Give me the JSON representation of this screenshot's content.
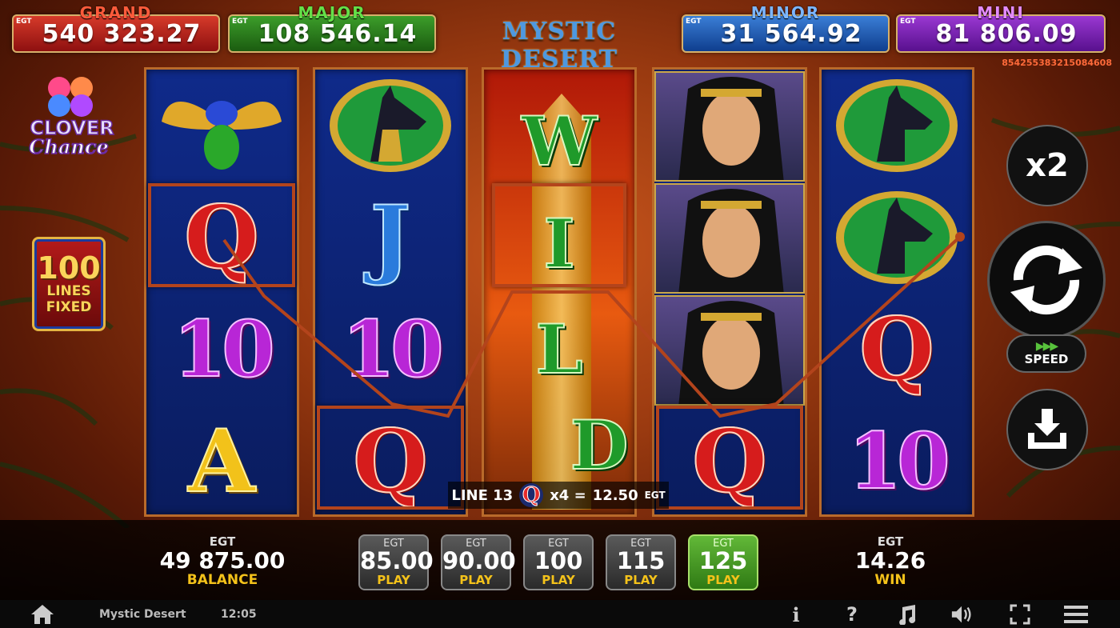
{
  "title": "MYSTIC DESERT",
  "round_id": "854255383215084608",
  "jackpots": {
    "grand": {
      "label": "GRAND",
      "currency": "EGT",
      "value": "540 323.27"
    },
    "major": {
      "label": "MAJOR",
      "currency": "EGT",
      "value": "108 546.14"
    },
    "minor": {
      "label": "MINOR",
      "currency": "EGT",
      "value": "31 564.92"
    },
    "mini": {
      "label": "MINI",
      "currency": "EGT",
      "value": "81 806.09"
    }
  },
  "logo": {
    "line1": "CLOVER",
    "line2": "Chance"
  },
  "lines_badge": {
    "number": "100",
    "line1": "LINES",
    "line2": "FIXED"
  },
  "reels": {
    "reel1": [
      "scarab",
      "Q",
      "10",
      "A"
    ],
    "reel2": [
      "anubis",
      "J",
      "10",
      "Q"
    ],
    "reel3": [
      "W",
      "I",
      "L",
      "D"
    ],
    "reel4": [
      "queen",
      "queen",
      "queen",
      "Q"
    ],
    "reel5": [
      "anubis",
      "anubis",
      "Q",
      "10"
    ]
  },
  "win_line": {
    "label": "LINE 13",
    "symbol": "Q",
    "multiplier": "x4 =",
    "amount": "12.50",
    "currency": "EGT"
  },
  "buttons": {
    "multiplier": "x2",
    "spin_icon": "refresh-icon",
    "speed_label": "SPEED",
    "speed_arrows": "▶▶▶",
    "collect_icon": "collect-icon"
  },
  "balance": {
    "currency": "EGT",
    "amount": "49 875.00",
    "label": "BALANCE"
  },
  "win": {
    "currency": "EGT",
    "amount": "14.26",
    "label": "WIN"
  },
  "bets": [
    {
      "currency": "EGT",
      "amount": "85.00",
      "label": "PLAY",
      "active": false
    },
    {
      "currency": "EGT",
      "amount": "90.00",
      "label": "PLAY",
      "active": false
    },
    {
      "currency": "EGT",
      "amount": "100",
      "label": "PLAY",
      "active": false
    },
    {
      "currency": "EGT",
      "amount": "115",
      "label": "PLAY",
      "active": false
    },
    {
      "currency": "EGT",
      "amount": "125",
      "label": "PLAY",
      "active": true
    }
  ],
  "status_bar": {
    "game_name": "Mystic Desert",
    "clock": "12:05",
    "icons": [
      "home-icon",
      "info-icon",
      "help-icon",
      "music-icon",
      "sound-icon",
      "fullscreen-icon",
      "menu-icon"
    ],
    "info_glyph": "i",
    "help_glyph": "?"
  },
  "colors": {
    "grand": "#b8231c",
    "major": "#2d7d1d",
    "minor": "#2863b8",
    "mini": "#7a24b0",
    "accent_gold": "#f4c21a",
    "active_bet": "#4f9e28"
  }
}
